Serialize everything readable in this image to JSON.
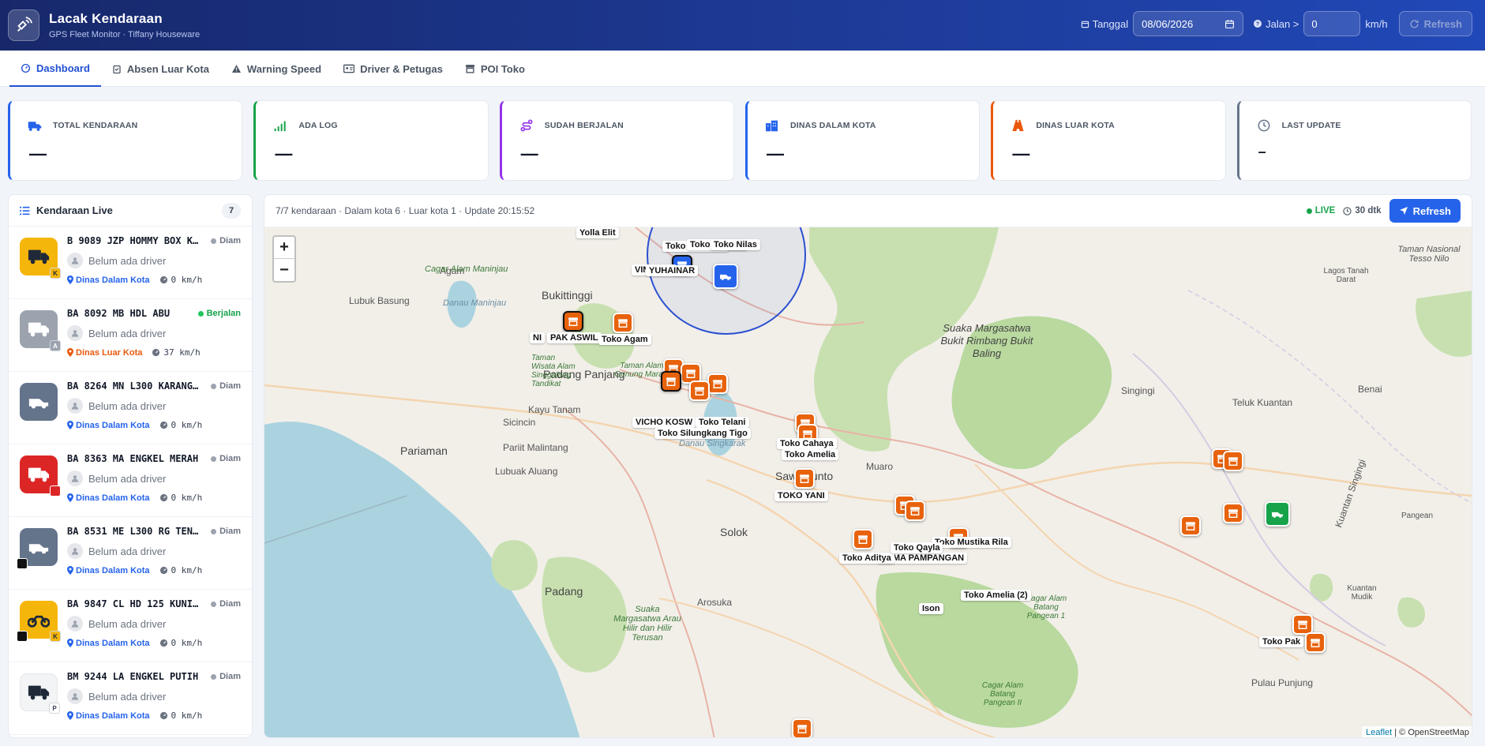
{
  "header": {
    "title": "Lacak Kendaraan",
    "subtitle": "GPS Fleet Monitor · Tiffany Houseware",
    "date_label": "Tanggal",
    "date_value": "08/06/2026",
    "speed_label": "Jalan >",
    "speed_value": "0",
    "speed_unit": "km/h",
    "refresh_label": "Refresh"
  },
  "tabs": [
    {
      "label": "Dashboard",
      "icon": "dashboard-icon",
      "active": true
    },
    {
      "label": "Absen Luar Kota",
      "icon": "clipboard-icon"
    },
    {
      "label": "Warning Speed",
      "icon": "warning-icon"
    },
    {
      "label": "Driver & Petugas",
      "icon": "id-card-icon"
    },
    {
      "label": "POI Toko",
      "icon": "store-icon"
    }
  ],
  "stats": [
    {
      "label": "TOTAL KENDARAAN",
      "value": "—",
      "color": "#2563eb"
    },
    {
      "label": "ADA LOG",
      "value": "—",
      "color": "#16a34a"
    },
    {
      "label": "SUDAH BERJALAN",
      "value": "—",
      "color": "#9333ea"
    },
    {
      "label": "DINAS DALAM KOTA",
      "value": "—",
      "color": "#2563eb"
    },
    {
      "label": "DINAS LUAR KOTA",
      "value": "—",
      "color": "#ea580c"
    },
    {
      "label": "LAST UPDATE",
      "value": "–",
      "color": "#64748b"
    }
  ],
  "sidebar": {
    "title": "Kendaraan Live",
    "count": "7",
    "vehicles": [
      {
        "plate": "B 9089 JZP HOMMY BOX K...",
        "status": "Diam",
        "driver": "Belum ada driver",
        "location": "Dinas Dalam Kota",
        "speed": "0 km/h",
        "badge": "K",
        "color": "#f5b60b"
      },
      {
        "plate": "BA 8092 MB HDL ABU",
        "status": "Berjalan",
        "driver": "Belum ada driver",
        "location": "Dinas Luar Kota",
        "speed": "37 km/h",
        "badge": "A",
        "color": "#9ca3af"
      },
      {
        "plate": "BA 8264 MN L300 KARANG...",
        "status": "Diam",
        "driver": "Belum ada driver",
        "location": "Dinas Dalam Kota",
        "speed": "0 km/h",
        "badge": "",
        "color": "#64748b"
      },
      {
        "plate": "BA 8363 MA ENGKEL MERAH",
        "status": "Diam",
        "driver": "Belum ada driver",
        "location": "Dinas Dalam Kota",
        "speed": "0 km/h",
        "badge": "",
        "color": "#dc2626"
      },
      {
        "plate": "BA 8531 ME L300 RG TEN...",
        "status": "Diam",
        "driver": "Belum ada driver",
        "location": "Dinas Dalam Kota",
        "speed": "0 km/h",
        "badge": "",
        "color": "#64748b"
      },
      {
        "plate": "BA 9847 CL HD 125 KUNI...",
        "status": "Diam",
        "driver": "Belum ada driver",
        "location": "Dinas Dalam Kota",
        "speed": "0 km/h",
        "badge": "K",
        "color": "#f5b60b"
      },
      {
        "plate": "BM 9244 LA ENGKEL PUTIH",
        "status": "Diam",
        "driver": "Belum ada driver",
        "location": "Dinas Dalam Kota",
        "speed": "0 km/h",
        "badge": "P",
        "color": "#f3f4f6"
      }
    ]
  },
  "map_panel": {
    "summary": "7/7 kendaraan · Dalam kota 6 · Luar kota 1 · Update 20:15:52",
    "live_label": "LIVE",
    "interval_label": "30 dtk",
    "refresh_label": "Refresh",
    "zoom_in": "+",
    "zoom_out": "−",
    "attribution_leaflet": "Leaflet",
    "attribution_rest": " | © OpenStreetMap"
  },
  "map_places": [
    "Bukittinggi",
    "Padang Panjang",
    "Pariaman",
    "Sicincin",
    "Kayu Tanam",
    "Pariit Malintang",
    "Lubuak Aluang",
    "Sawahlunto",
    "Solok",
    "Padang",
    "Arosuka",
    "Lubuk Basung",
    "Agam",
    "Muaro",
    "Teluk Kuantan",
    "Cagar Alam Maninjau",
    "Danau Maninjau",
    "Danau Singkarak",
    "Pulau Punjung",
    "Kuantan Singingi",
    "Singingi",
    "Benai",
    "Lagos Tanah Darat",
    "Taman Nasional Tesso Nilo",
    "Kuantan Mudik",
    "Pangean"
  ],
  "map_green_places": [
    "Suaka Margasatwa Bukit Rimbang Bukit Baling",
    "Suaka Margasatwa Arau Hilir dan Hilir Terusan",
    "Taman Wisata Alam Singgalang Tandikat",
    "Taman Alam Gunung Marapi",
    "Cagar Alam Batang Pangean 1",
    "Cagar Alam Batang Pangean II"
  ],
  "map_markers": [
    "Yolla Elit",
    "Toko Mustika",
    "Toko Nilas",
    "Toko Sinar Pla",
    "VINSPRA",
    "YUHAINAR",
    "PAK ASWIL",
    "NI",
    "Toko Agam",
    "Toko Telani",
    "VICHO KOSW",
    "Toko Silungkang Tigo",
    "Toko Cahaya",
    "Toko Amelia",
    "TOKO YANI",
    "Toko Mustika Rila",
    "NAMA PAMPANGAN",
    "Toko Aditya",
    "Toko Qayla",
    "Toko Amelia (2)",
    "Ison",
    "Toko Pak"
  ]
}
